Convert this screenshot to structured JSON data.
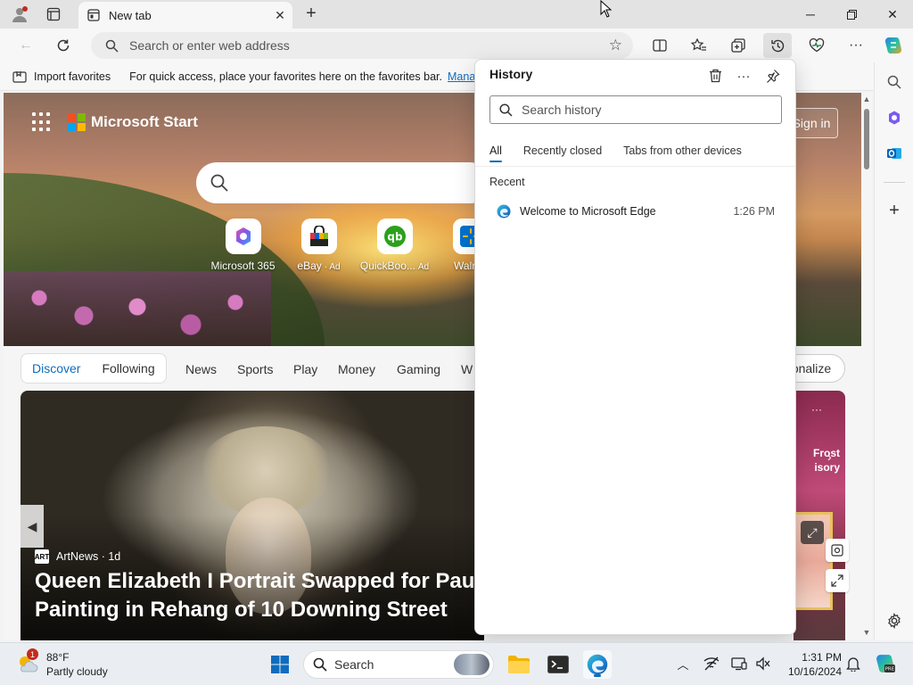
{
  "browser": {
    "tab_title": "New tab",
    "address_placeholder": "Search or enter web address"
  },
  "favorites_bar": {
    "import_label": "Import favorites",
    "message": "For quick access, place your favorites here on the favorites bar.",
    "manage_link": "Manage"
  },
  "start_page": {
    "brand": "Microsoft Start",
    "signin_label": "Sign in",
    "quicklinks": [
      {
        "label": "Microsoft 365",
        "ad": ""
      },
      {
        "label": "eBay",
        "ad": "· Ad"
      },
      {
        "label": "QuickBoo...",
        "ad": "Ad"
      },
      {
        "label": "Walma",
        "ad": ""
      }
    ],
    "feed_tabs": {
      "discover": "Discover",
      "following": "Following"
    },
    "categories": [
      "News",
      "Sports",
      "Play",
      "Money",
      "Gaming",
      "W"
    ],
    "personalize_label": "onalize",
    "card": {
      "source_logo": "ART",
      "source": "ArtNews · 1d",
      "headline_line1": "Queen Elizabeth I Portrait Swapped for Paula",
      "headline_line2": "Painting in Rehang of 10 Downing Street"
    },
    "card2": {
      "line1": "Frost",
      "line2": "isory",
      "more": "···"
    }
  },
  "history_panel": {
    "title": "History",
    "search_placeholder": "Search history",
    "tabs": [
      "All",
      "Recently closed",
      "Tabs from other devices"
    ],
    "section": "Recent",
    "items": [
      {
        "title": "Welcome to Microsoft Edge",
        "time": "1:26 PM"
      }
    ]
  },
  "taskbar": {
    "weather_temp": "88°F",
    "weather_desc": "Partly cloudy",
    "weather_badge": "1",
    "search_label": "Search",
    "time": "1:31 PM",
    "date": "10/16/2024"
  },
  "colors": {
    "accent": "#0f6cbd",
    "edge_blue": "#0c59a4",
    "taskbar": "#eaeef3"
  }
}
